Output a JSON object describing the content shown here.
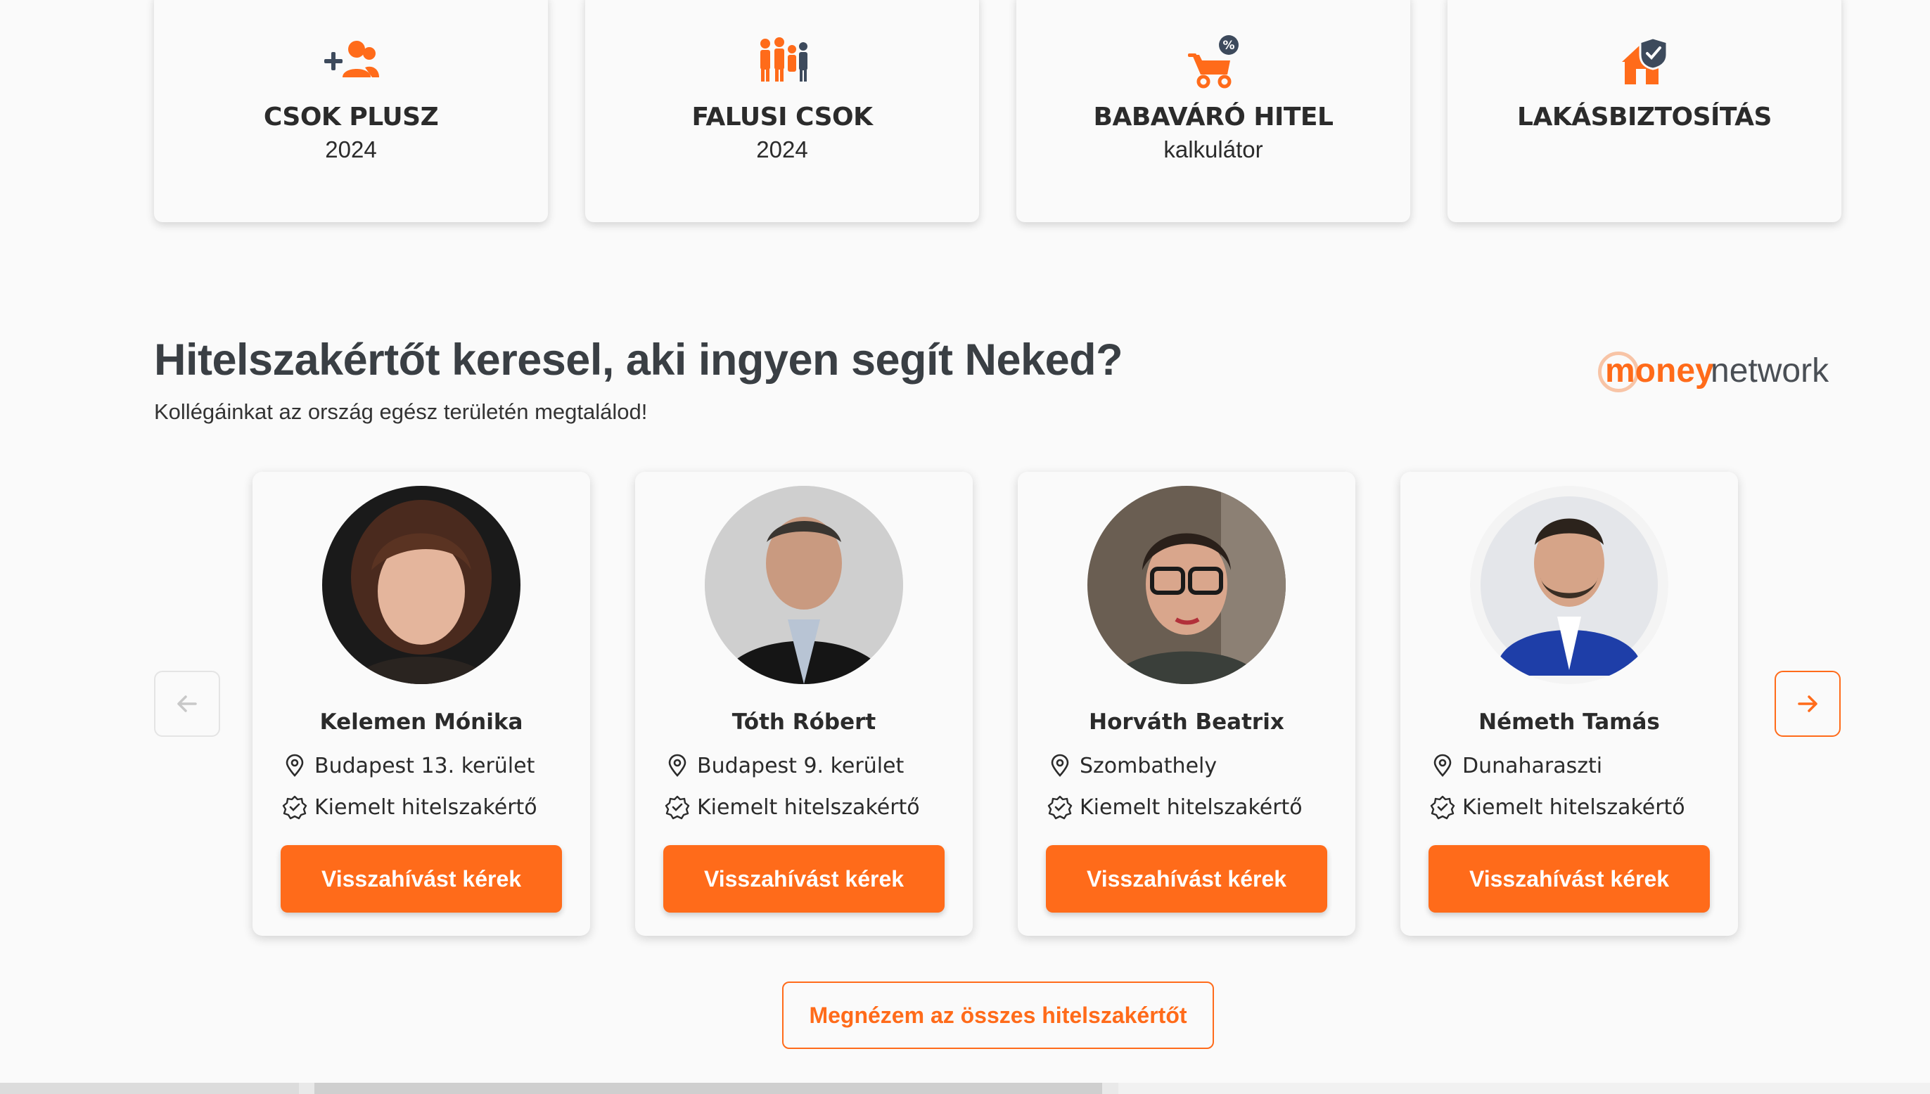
{
  "categories": [
    {
      "title": "CSOK PLUSZ",
      "subtitle": "2024",
      "icon": "family-add-icon"
    },
    {
      "title": "FALUSI CSOK",
      "subtitle": "2024",
      "icon": "family-village-icon"
    },
    {
      "title": "BABAVÁRÓ HITEL",
      "subtitle": "kalkulátor",
      "icon": "stroller-percent-icon"
    },
    {
      "title": "LAKÁSBIZTOSÍTÁS",
      "subtitle": "",
      "icon": "house-shield-icon"
    }
  ],
  "section": {
    "title": "Hitelszakértőt keresel, aki ingyen segít Neked?",
    "subtitle": "Kollégáinkat az ország egész területén megtalálod!",
    "brand_money": "money",
    "brand_network": "network"
  },
  "experts": [
    {
      "name": "Kelemen Mónika",
      "location": "Budapest 13. kerület",
      "badge": "Kiemelt hitelszakértő",
      "cta": "Visszahívást kérek"
    },
    {
      "name": "Tóth Róbert",
      "location": "Budapest 9. kerület",
      "badge": "Kiemelt hitelszakértő",
      "cta": "Visszahívást kérek"
    },
    {
      "name": "Horváth Beatrix",
      "location": "Szombathely",
      "badge": "Kiemelt hitelszakértő",
      "cta": "Visszahívást kérek"
    },
    {
      "name": "Németh Tamás",
      "location": "Dunaharaszti",
      "badge": "Kiemelt hitelszakértő",
      "cta": "Visszahívást kérek"
    }
  ],
  "all_experts_label": "Megnézem az összes hitelszakértőt",
  "colors": {
    "accent": "#ff6b1a",
    "navy": "#3d4a5c",
    "text": "#2b2b2b"
  }
}
